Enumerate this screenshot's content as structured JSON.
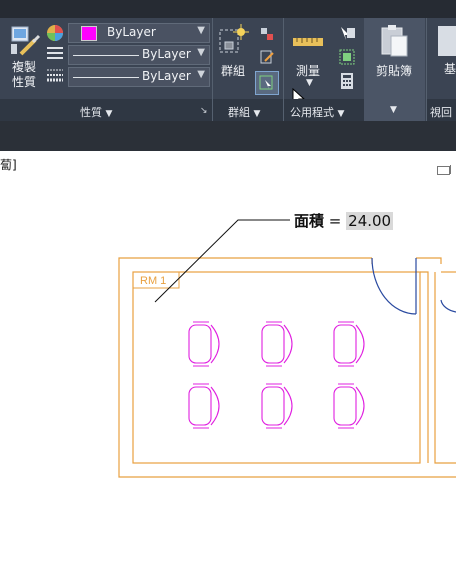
{
  "ribbon": {
    "properties": {
      "copy_props_label": "複製\n性質",
      "color_value": "ByLayer",
      "linetype_value": "ByLayer",
      "lineweight_value": "ByLayer",
      "panel_title": "性質",
      "color_swatch": "#ff00ff"
    },
    "groups": {
      "group_label": "群組",
      "panel_title": "群組"
    },
    "utilities": {
      "measure_label": "測量",
      "panel_title": "公用程式"
    },
    "clipboard": {
      "paste_label": "剪貼簿"
    },
    "view": {
      "base_label": "基",
      "panel_title": "視回"
    }
  },
  "canvas": {
    "title_fragment": "蔔]",
    "room_tag": "RM  1",
    "area_prefix": "面積",
    "area_equals": "=",
    "area_value": "24.00"
  }
}
